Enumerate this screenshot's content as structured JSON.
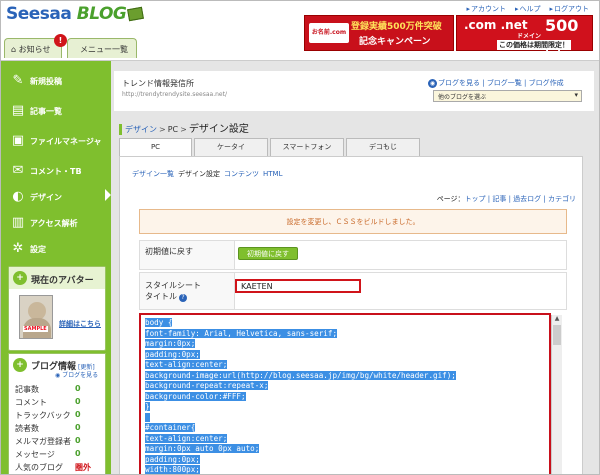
{
  "header": {
    "logo_main": "Seesaa",
    "logo_blog": "BLOG",
    "links": [
      "アカウント",
      "ヘルプ",
      "ログアウト"
    ],
    "tabs": {
      "oshirase": "お知らせ",
      "badge": "!",
      "menu": "メニュー一覧"
    },
    "banner1": {
      "logo": "お名前.com",
      "line1": "登録実績500万件突破",
      "line2": "記念キャンペーン"
    },
    "banner2": {
      "domain": ".com .net",
      "small": "ドメイン",
      "price": "500円",
      "note": "この価格は期間限定！"
    }
  },
  "sidebar": {
    "items": [
      {
        "label": "新規投稿",
        "icon": "✎"
      },
      {
        "label": "記事一覧",
        "icon": "▤"
      },
      {
        "label": "ファイルマネージャ",
        "icon": "▣"
      },
      {
        "label": "コメント・TB",
        "icon": "✉"
      },
      {
        "label": "デザイン",
        "icon": "◐"
      },
      {
        "label": "アクセス解析",
        "icon": "▥"
      },
      {
        "label": "設定",
        "icon": "✲"
      }
    ],
    "avatar": {
      "title": "現在のアバター",
      "sample": "SAMPLE",
      "link": "詳細はこちら"
    },
    "info": {
      "title": "ブログ情報",
      "update": "[更新]",
      "view_blog": "ブログを見る",
      "stats": [
        {
          "label": "記事数",
          "value": "0"
        },
        {
          "label": "コメント",
          "value": "0"
        },
        {
          "label": "トラックバック",
          "value": "0"
        },
        {
          "label": "読者数",
          "value": "0"
        },
        {
          "label": "メルマガ登録者",
          "value": "0"
        },
        {
          "label": "メッセージ",
          "value": "0"
        },
        {
          "label": "人気のブログ",
          "value": "圏外"
        }
      ]
    }
  },
  "main": {
    "site_name": "トレンド情報発信所",
    "site_url": "http://trendytrendysite.seesaa.net/",
    "blog_links": {
      "view": "ブログを見る",
      "list": "ブログ一覧",
      "create": "ブログ作成"
    },
    "blog_select": "他のブログを選ぶ",
    "breadcrumb": {
      "design": "デザイン",
      "pc": "PC",
      "current": "デザイン設定"
    },
    "tabs": [
      "PC",
      "ケータイ",
      "スマートフォン",
      "デコもじ"
    ],
    "subnav": [
      "デザイン一覧",
      "デザイン設定",
      "コンテンツ",
      "HTML"
    ],
    "page_links": {
      "label": "ページ：",
      "top": "トップ",
      "article": "記事",
      "archive": "過去ログ",
      "category": "カテゴリ"
    },
    "message": "設定を変更し、ＣＳＳをビルドしました。",
    "reset": {
      "label": "初期値に戻す",
      "button": "初期値に戻す"
    },
    "stylesheet": {
      "label1": "スタイルシート",
      "label2": "タイトル",
      "value": "KAETEN"
    },
    "css_lines": [
      "body {",
      "font-family: Arial, Helvetica, sans-serif;",
      "margin:0px;",
      "padding:0px;",
      "text-align:center;",
      "background-image:url(http://blog.seesaa.jp/img/bg/white/header.gif);",
      "background-repeat:repeat-x;",
      "background-color:#FFF;",
      "}",
      "",
      "#container{",
      "text-align:center;",
      "margin:0px auto 0px auto;",
      "padding:0px;",
      "width:800px;",
      "}"
    ]
  }
}
